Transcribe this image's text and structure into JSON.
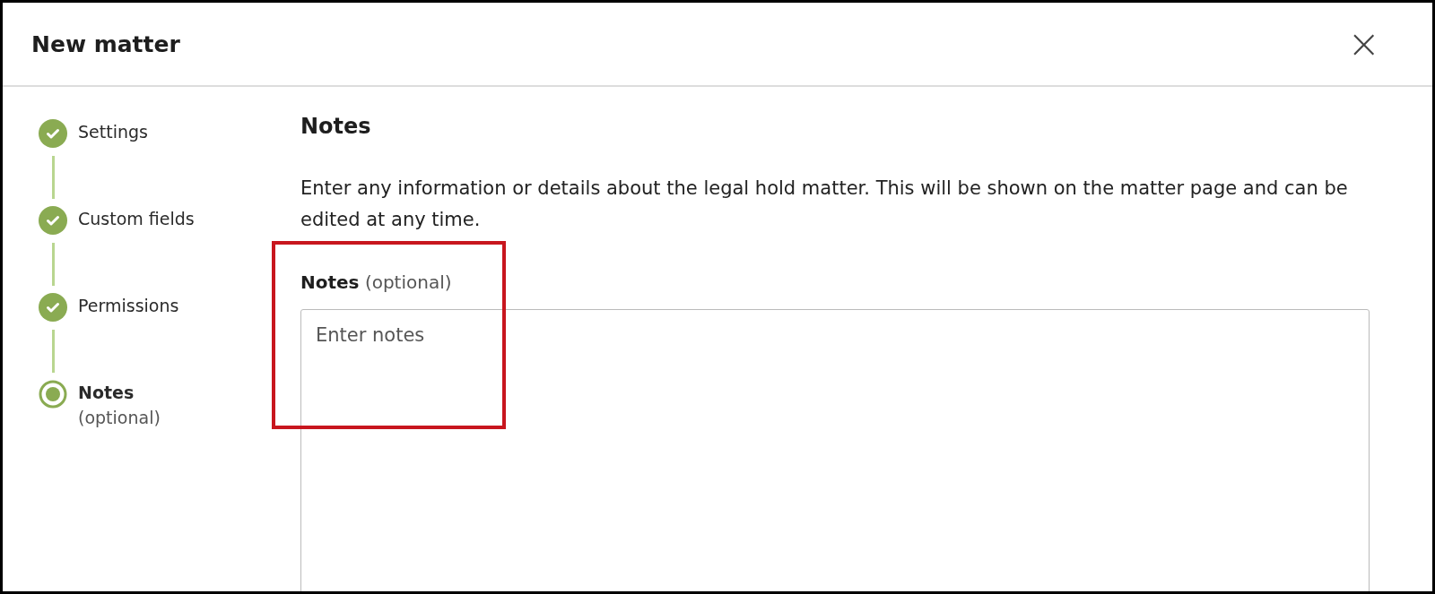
{
  "dialog": {
    "title": "New matter",
    "close_label": "×"
  },
  "steps": [
    {
      "label": "Settings",
      "completed": true,
      "current": false
    },
    {
      "label": "Custom fields",
      "completed": true,
      "current": false
    },
    {
      "label": "Permissions",
      "completed": true,
      "current": false
    },
    {
      "label": "Notes",
      "sublabel": "(optional)",
      "completed": false,
      "current": true
    }
  ],
  "section": {
    "heading": "Notes",
    "description": "Enter any information or details about the legal hold matter. This will be shown on the matter page and can be edited at any time.",
    "field_label": "Notes",
    "field_hint": "(optional)",
    "placeholder": "Enter notes"
  },
  "annotation": {
    "kind": "highlight"
  }
}
